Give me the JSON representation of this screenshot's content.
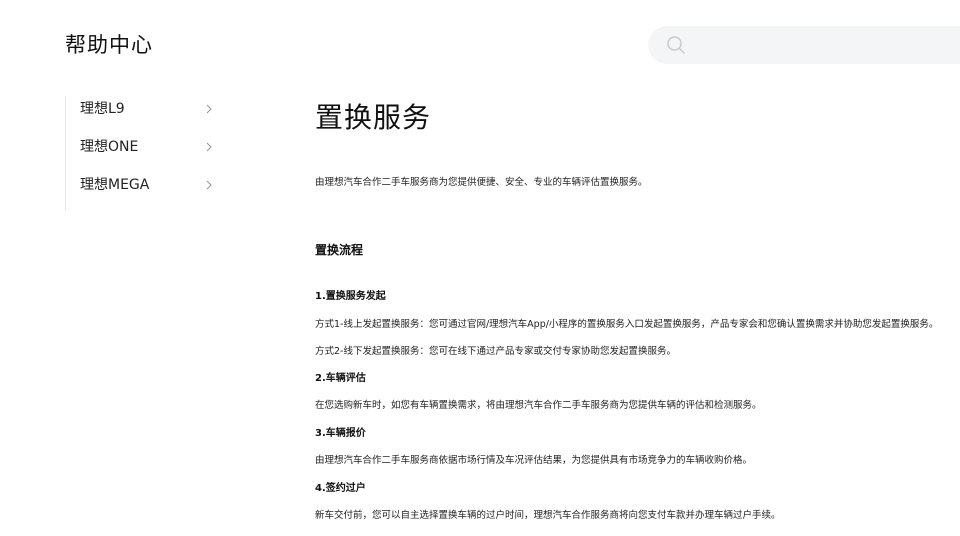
{
  "header": {
    "title": "帮助中心",
    "search": {
      "icon": "search-icon",
      "placeholder": ""
    }
  },
  "sidebar": {
    "items": [
      {
        "label": "理想L9",
        "icon": "chevron-right-icon"
      },
      {
        "label": "理想ONE",
        "icon": "chevron-right-icon"
      },
      {
        "label": "理想MEGA",
        "icon": "chevron-right-icon"
      }
    ]
  },
  "main": {
    "title": "置换服务",
    "intro": "由理想汽车合作二手车服务商为您提供便捷、安全、专业的车辆评估置换服务。",
    "section_heading": "置换流程",
    "steps": [
      {
        "title": "1.置换服务发起",
        "lines": [
          "方式1-线上发起置换服务：您可通过官网/理想汽车App/小程序的置换服务入口发起置换服务，产品专家会和您确认置换需求并协助您发起置换服务。",
          "方式2-线下发起置换服务：您可在线下通过产品专家或交付专家协助您发起置换服务。"
        ]
      },
      {
        "title": "2.车辆评估",
        "lines": [
          "在您选购新车时，如您有车辆置换需求，将由理想汽车合作二手车服务商为您提供车辆的评估和检测服务。"
        ]
      },
      {
        "title": "3.车辆报价",
        "lines": [
          "由理想汽车合作二手车服务商依据市场行情及车况评估结果，为您提供具有市场竞争力的车辆收购价格。"
        ]
      },
      {
        "title": "4.签约过户",
        "lines": [
          "新车交付前，您可以自主选择置换车辆的过户时间，理想汽车合作服务商将向您支付车款并办理车辆过户手续。"
        ]
      }
    ]
  }
}
